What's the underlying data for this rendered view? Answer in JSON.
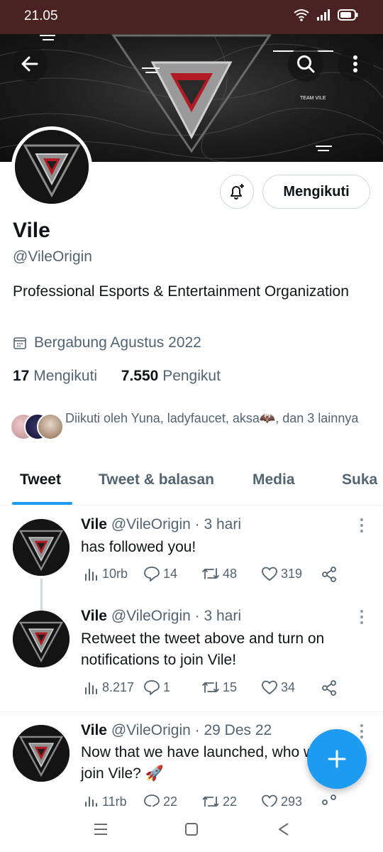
{
  "status_bar": {
    "time": "21.05",
    "icons": [
      "wifi-icon",
      "signal-icon",
      "battery-icon"
    ]
  },
  "header": {
    "back_icon": "arrow-left-icon",
    "search_icon": "search-icon",
    "more_icon": "more-vertical-icon",
    "banner_tag": "TEAM VILE"
  },
  "profile": {
    "name": "Vile",
    "handle": "@VileOrigin",
    "bio": "Professional Esports & Entertainment Organization",
    "joined": "Bergabung Agustus 2022",
    "following_count": "17",
    "following_label": "Mengikuti",
    "followers_count": "7.550",
    "followers_label": "Pengikut",
    "follow_button_label": "Mengikuti",
    "followed_by": "Diikuti oleh Yuna, ladyfaucet, aksa🦇, dan 3 lainnya"
  },
  "tabs": [
    {
      "label": "Tweet",
      "active": true
    },
    {
      "label": "Tweet & balasan",
      "active": false
    },
    {
      "label": "Media",
      "active": false
    },
    {
      "label": "Suka",
      "active": false
    }
  ],
  "tweets": [
    {
      "name": "Vile",
      "handle": "@VileOrigin",
      "time": "3 hari",
      "text": "has followed you!",
      "views": "10rb",
      "replies": "14",
      "retweets": "48",
      "likes": "319"
    },
    {
      "name": "Vile",
      "handle": "@VileOrigin",
      "time": "3 hari",
      "text": "Retweet the tweet above and turn on notifications to join Vile!",
      "views": "8.217",
      "replies": "1",
      "retweets": "15",
      "likes": "34"
    },
    {
      "name": "Vile",
      "handle": "@VileOrigin",
      "time": "29 Des 22",
      "text": "Now that we have launched, who wants to join Vile? 🚀",
      "views": "11rb",
      "replies": "22",
      "retweets": "22",
      "likes": "293"
    }
  ],
  "colors": {
    "accent": "#1d9bf0",
    "text": "#0f1419",
    "secondary": "#536471",
    "status_bar": "#4a2222"
  }
}
